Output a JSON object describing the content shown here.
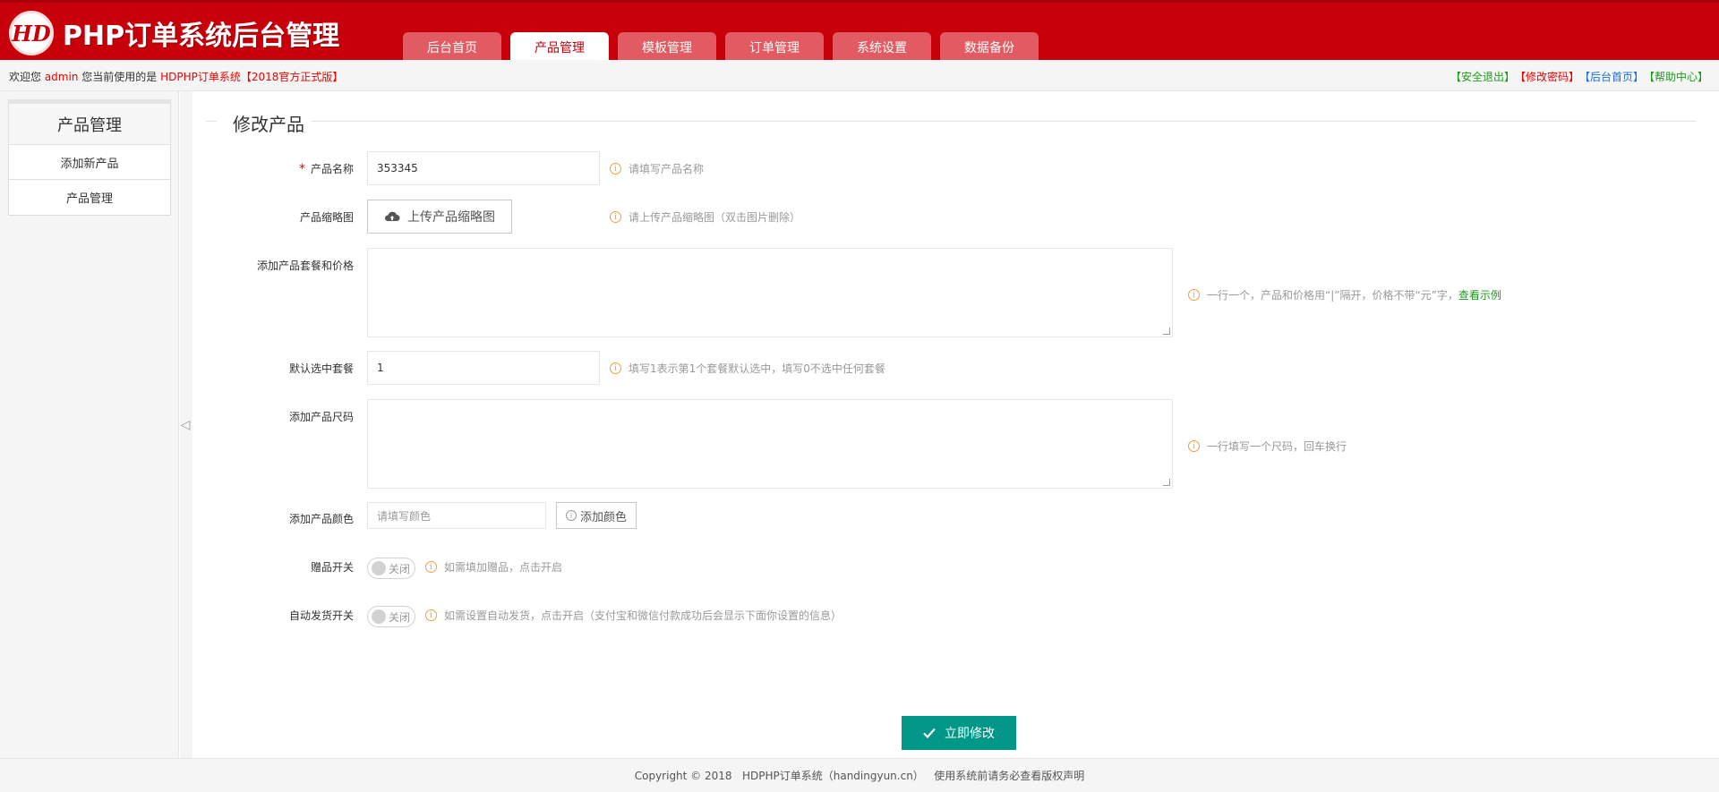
{
  "header": {
    "logo_mark": "HD",
    "title": "PHP订单系统后台管理",
    "nav": [
      {
        "label": "后台首页",
        "active": false
      },
      {
        "label": "产品管理",
        "active": true
      },
      {
        "label": "模板管理",
        "active": false
      },
      {
        "label": "订单管理",
        "active": false
      },
      {
        "label": "系统设置",
        "active": false
      },
      {
        "label": "数据备份",
        "active": false
      }
    ]
  },
  "welcome": {
    "prefix": "欢迎您 ",
    "user": "admin",
    "middle": " 您当前使用的是 ",
    "version": "HDPHP订单系统【2018官方正式版】",
    "links": {
      "logout": "【安全退出】",
      "change_password": "【修改密码】",
      "home": "【后台首页】",
      "help": "【帮助中心】"
    }
  },
  "sidebar": {
    "title": "产品管理",
    "items": [
      "添加新产品",
      "产品管理"
    ]
  },
  "form": {
    "legend": "修改产品",
    "name": {
      "label": "产品名称",
      "value": "353345",
      "tip": "请填写产品名称"
    },
    "thumb": {
      "label": "产品缩略图",
      "button": "上传产品缩略图",
      "tip": "请上传产品缩略图（双击图片删除）"
    },
    "packages": {
      "label": "添加产品套餐和价格",
      "tip": "一行一个，产品和价格用“|”隔开，价格不带“元”字，",
      "tip_link": "查看示例"
    },
    "default_package": {
      "label": "默认选中套餐",
      "value": "1",
      "tip": "填写1表示第1个套餐默认选中，填写0不选中任何套餐"
    },
    "sizes": {
      "label": "添加产品尺码",
      "tip": "一行填写一个尺码，回车换行"
    },
    "colors": {
      "label": "添加产品颜色",
      "placeholder": "请填写颜色",
      "button": "添加颜色"
    },
    "gift": {
      "label": "赠品开关",
      "switch_text": "关闭",
      "tip": "如需填加赠品，点击开启"
    },
    "auto_ship": {
      "label": "自动发货开关",
      "switch_text": "关闭",
      "tip": "如需设置自动发货，点击开启（支付宝和微信付款成功后会显示下面你设置的信息）"
    },
    "submit": "立即修改"
  },
  "footer": {
    "text": "Copyright © 2018   HDPHP订单系统（handingyun.cn）   使用系统前请务必查看版权声明"
  },
  "colors": {
    "brand_red": "#c8000a",
    "tab_inactive": "#e25b62",
    "submit_teal": "#009688",
    "tip_orange": "#f0a040"
  }
}
